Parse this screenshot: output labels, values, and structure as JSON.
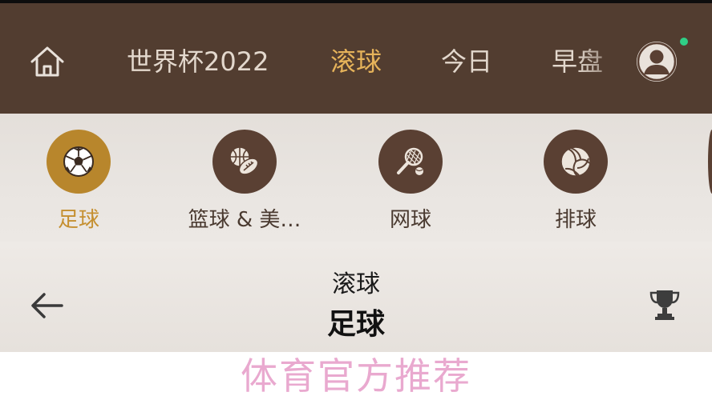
{
  "topbar": {
    "icons": {
      "home": "home-icon",
      "avatar": "user-avatar-icon"
    },
    "tabs": [
      {
        "label": "世界杯2022",
        "active": false
      },
      {
        "label": "滚球",
        "active": true
      },
      {
        "label": "今日",
        "active": false
      },
      {
        "label": "早盘",
        "active": false
      }
    ],
    "colors": {
      "bar": "#523d30",
      "tab": "#e3d8cd",
      "active_tab": "#e6b35a",
      "online_dot": "#2fcf86"
    }
  },
  "sports": {
    "items": [
      {
        "label": "足球",
        "icon": "soccer-ball-icon",
        "active": true
      },
      {
        "label": "篮球 & 美…",
        "icon": "basketball-football-icon",
        "active": false
      },
      {
        "label": "网球",
        "icon": "tennis-icon",
        "active": false
      },
      {
        "label": "排球",
        "icon": "volleyball-icon",
        "active": false
      }
    ],
    "colors": {
      "circle": "#5a4033",
      "active_circle": "#b8862c",
      "active_label": "#c58f2f"
    }
  },
  "header": {
    "subtitle": "滚球",
    "title": "足球",
    "icons": {
      "back": "arrow-left-icon",
      "trophy": "trophy-icon"
    }
  },
  "watermark": {
    "text": "体育官方推荐",
    "color": "#e9a9cf"
  }
}
